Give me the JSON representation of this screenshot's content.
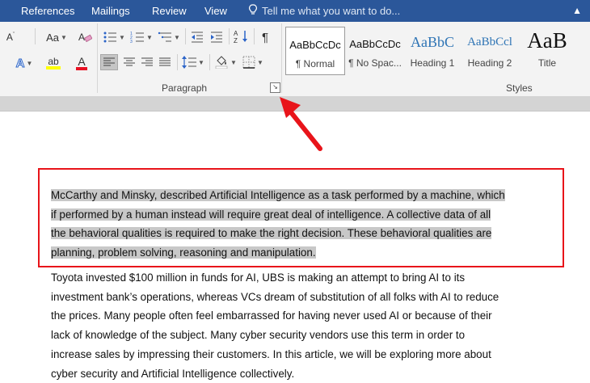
{
  "menu": {
    "tabs": [
      "References",
      "Mailings",
      "Review",
      "View"
    ],
    "tell_me": "Tell me what you want to do..."
  },
  "ribbon": {
    "paragraph_group_label": "Paragraph",
    "styles_group_label": "Styles",
    "font_buttons": {
      "case_label": "Aa",
      "effects_label": "A",
      "highlight_label": "ab",
      "color_label": "A",
      "highlight_color": "#ffff00",
      "font_color": "#e81123"
    },
    "paragraph_buttons": {
      "pilcrow": "¶",
      "sort_label": "A↓Z"
    },
    "styles": [
      {
        "sample": "AaBbCcDc",
        "name": "¶ Normal",
        "selected": true
      },
      {
        "sample": "AaBbCcDc",
        "name": "¶ No Spac..."
      },
      {
        "sample": "AaBbC",
        "name": "Heading 1"
      },
      {
        "sample": "AaBbCcl",
        "name": "Heading 2"
      },
      {
        "sample": "AaB",
        "name": "Title"
      }
    ]
  },
  "document": {
    "paragraph1_lines": [
      "McCarthy and Minsky, described Artificial Intelligence as a task performed by a machine, which",
      "if performed by a human instead will require great deal of intelligence. A collective data of all",
      "the behavioral qualities is required to make the right decision. These behavioral qualities are",
      "planning, problem solving, reasoning and manipulation. "
    ],
    "paragraph2_lines": [
      "Toyota invested $100 million in funds for AI, UBS is making an attempt to bring AI to its",
      "investment bank’s operations, whereas VCs dream of substitution of all folks with AI to reduce",
      "the prices. Many people often feel embarrassed for having never used AI or because of their",
      "lack of knowledge of the subject. Many cyber security vendors use this term in order to",
      "increase sales by impressing their customers. In this article, we will be exploring more about",
      "cyber security and Artificial Intelligence collectively."
    ]
  },
  "colors": {
    "ribbon_blue": "#2b579a",
    "annotation_red": "#e8141a",
    "selection_gray": "#c8c8c8"
  }
}
